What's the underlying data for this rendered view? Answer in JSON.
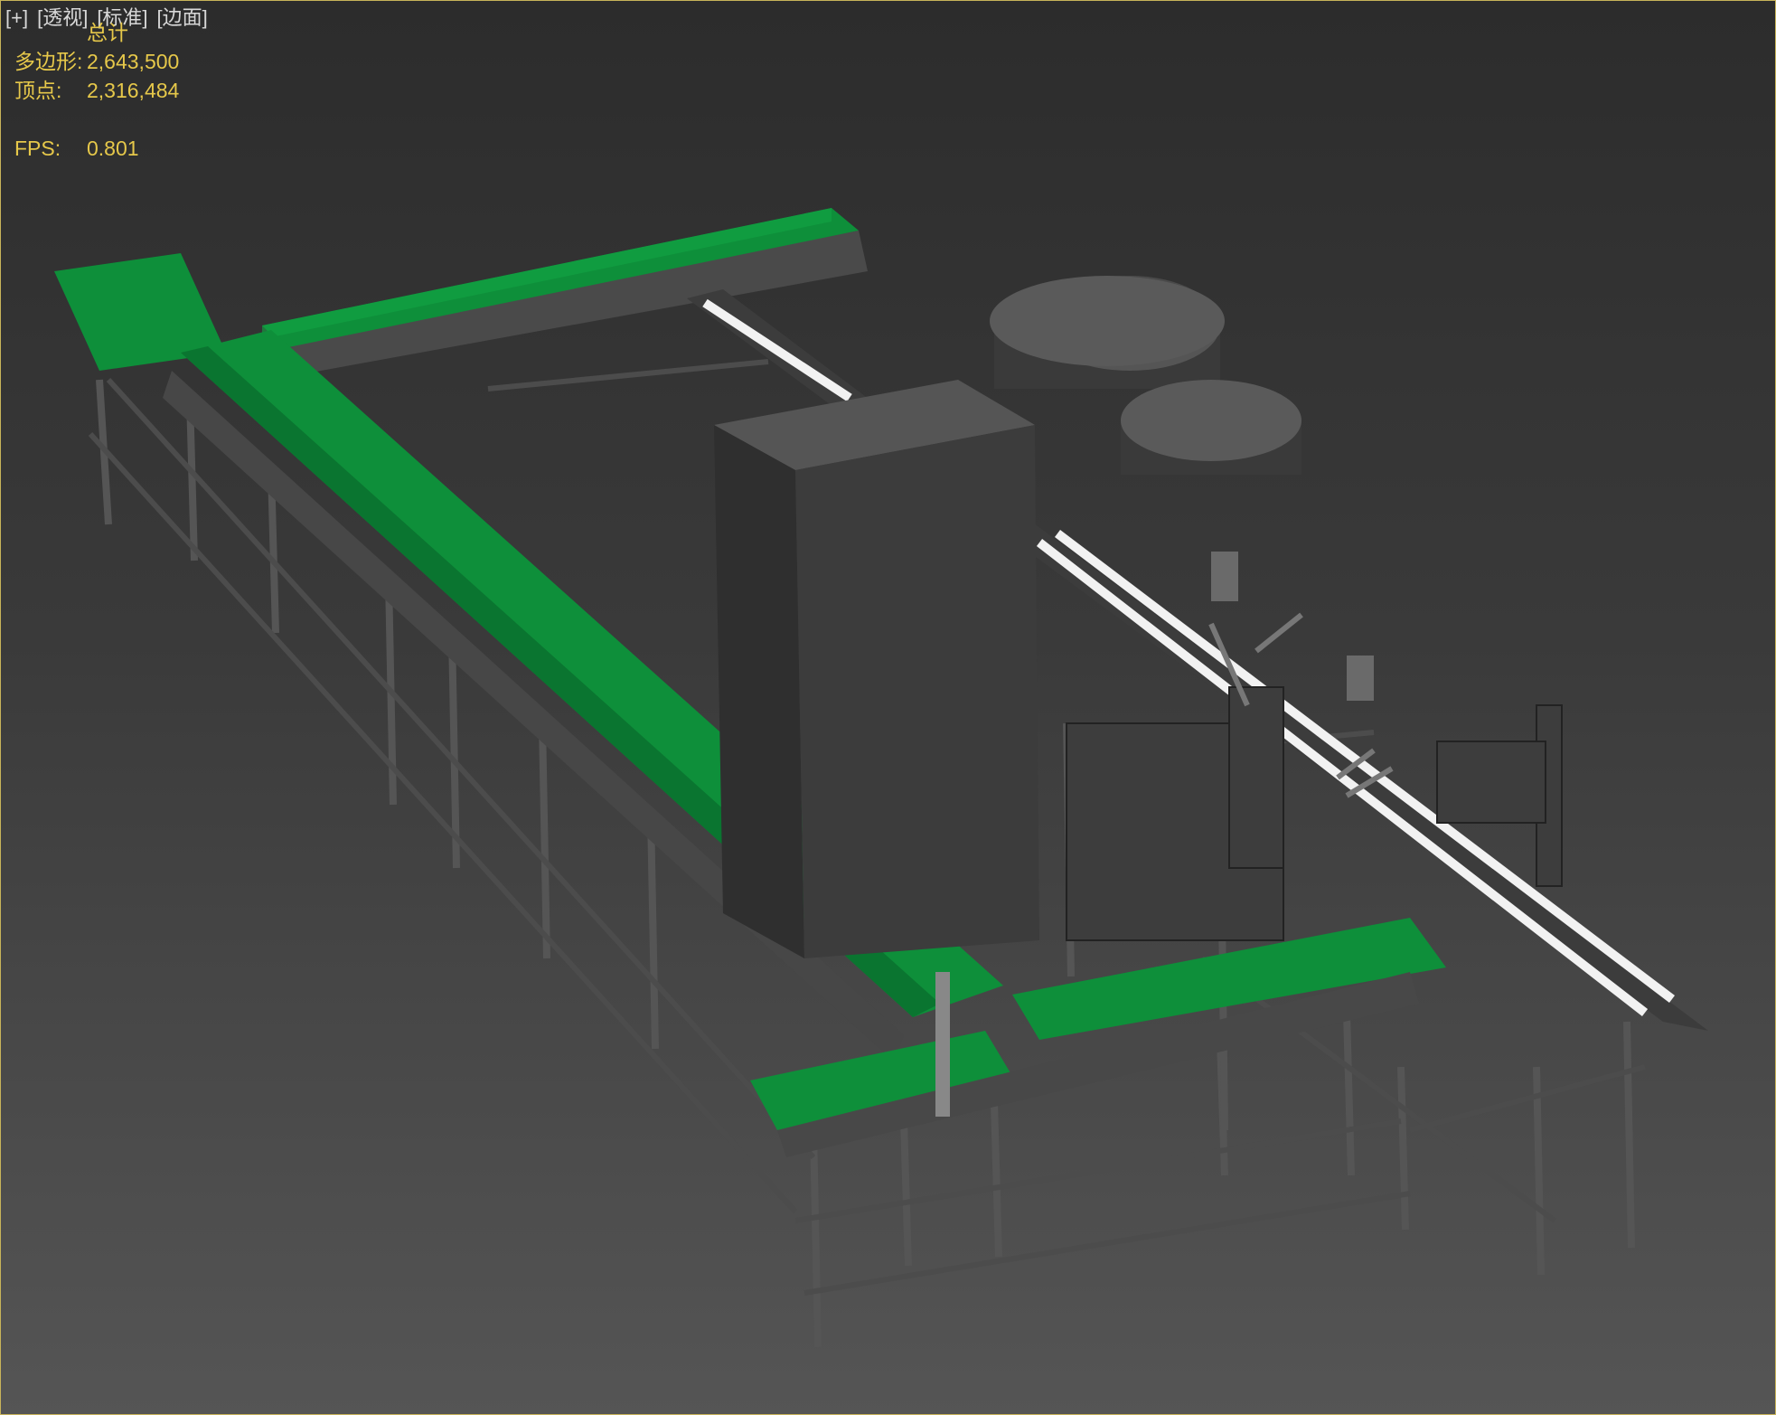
{
  "viewport": {
    "labels": [
      "[+]",
      "[透视]",
      "[标准]",
      "[边面]"
    ]
  },
  "stats": {
    "title": "总计",
    "polygons_label": "多边形:",
    "polygons_value": "2,643,500",
    "vertices_label": "顶点:",
    "vertices_value": "2,316,484",
    "fps_label": "FPS:",
    "fps_value": "0.801"
  },
  "colors": {
    "belt_green": "#0e8f3a",
    "frame_gray": "#5a5a5a",
    "box_gray": "#3e3e3e",
    "stats_yellow": "#e6c84a"
  }
}
